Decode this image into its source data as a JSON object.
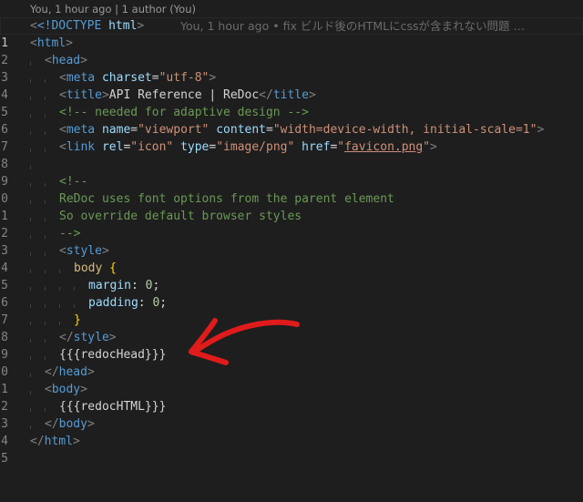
{
  "codelens": "You, 1 hour ago | 1 author (You)",
  "inline_blame": "You, 1 hour ago • fix ビルド後のHTMLにcssが含まれない問題 …",
  "colors": {
    "background": "#1e1e1e",
    "tag": "#569cd6",
    "attribute": "#9cdcfe",
    "string": "#ce9178",
    "comment": "#6a9955",
    "number": "#b5cea8",
    "annotation_arrow": "#e01b1b"
  },
  "lines": [
    {
      "n": "1",
      "active": true
    },
    {
      "n": "2"
    },
    {
      "n": "3"
    },
    {
      "n": "4"
    },
    {
      "n": "5"
    },
    {
      "n": "6"
    },
    {
      "n": "7"
    },
    {
      "n": "8"
    },
    {
      "n": "9"
    },
    {
      "n": "0"
    },
    {
      "n": "1"
    },
    {
      "n": "2"
    },
    {
      "n": "3"
    },
    {
      "n": "4"
    },
    {
      "n": "5"
    },
    {
      "n": "6"
    },
    {
      "n": "7"
    },
    {
      "n": "8"
    },
    {
      "n": "9"
    },
    {
      "n": "0"
    },
    {
      "n": "1"
    },
    {
      "n": "2"
    },
    {
      "n": "3"
    },
    {
      "n": "4"
    },
    {
      "n": "5"
    }
  ],
  "code": {
    "doctype": "<!DOCTYPE",
    "doctype_name": "html",
    "html": "html",
    "head": "head",
    "meta": "meta",
    "charset_attr": "charset",
    "charset_val": "\"utf-8\"",
    "title": "title",
    "title_text": "API Reference | ReDoc",
    "comment_adaptive": "<!-- needed for adaptive design -->",
    "name_attr": "name",
    "name_val": "\"viewport\"",
    "content_attr": "content",
    "content_val": "\"width=device-width, initial-scale=1\"",
    "link": "link",
    "rel_attr": "rel",
    "rel_val": "\"icon\"",
    "type_attr": "type",
    "type_val": "\"image/png\"",
    "href_attr": "href",
    "href_q1": "\"",
    "href_val": "favicon.png",
    "href_q2": "\"",
    "comment_open": "<!--",
    "comment_line1": "ReDoc uses font options from the parent element",
    "comment_line2": "So override default browser styles",
    "comment_close": "-->",
    "style": "style",
    "selector_body": "body",
    "brace_open": "{",
    "prop_margin": "margin",
    "prop_padding": "padding",
    "zero": "0",
    "brace_close": "}",
    "redoc_head": "{{{redocHead}}}",
    "body": "body",
    "redoc_html": "{{{redocHTML}}}"
  }
}
